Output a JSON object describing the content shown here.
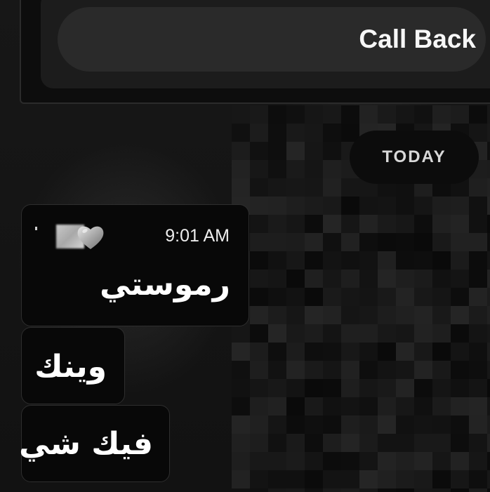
{
  "call_card": {
    "button_label": "Call Back"
  },
  "chat": {
    "date_divider": "TODAY",
    "messages": [
      {
        "time": "9:01 AM",
        "text": "رموستي"
      },
      {
        "text": "وينك"
      },
      {
        "text": "فيك شي"
      }
    ]
  },
  "icons": {
    "reaction": "grey-heart-icon"
  },
  "colors": {
    "background": "#131313",
    "bubble": "#080808",
    "bubble_border": "#2e2e2e",
    "pill": "#0c0c0c",
    "button": "#2a2a2a",
    "text": "#ffffff"
  }
}
